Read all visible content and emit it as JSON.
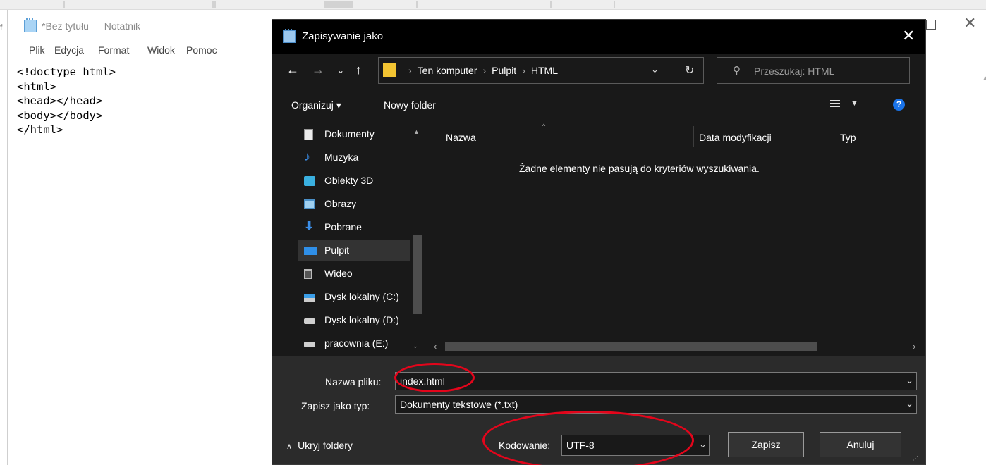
{
  "notepad": {
    "left_letter": "f",
    "title": "*Bez tytułu — Notatnik",
    "menu": [
      "Plik",
      "Edycja",
      "Format",
      "Widok",
      "Pomoc"
    ],
    "lines": [
      "<!doctype html>",
      "<html>",
      "<head></head>",
      "<body></body>",
      "</html>"
    ]
  },
  "dialog": {
    "title": "Zapisywanie jako",
    "address": {
      "segments": [
        "Ten komputer",
        "Pulpit",
        "HTML"
      ]
    },
    "search_placeholder": "Przeszukaj: HTML",
    "toolbar": {
      "organize": "Organizuj ▾",
      "new_folder": "Nowy folder"
    },
    "nav": {
      "items": [
        {
          "label": "Dokumenty",
          "icon": "documents-icon"
        },
        {
          "label": "Muzyka",
          "icon": "music-icon"
        },
        {
          "label": "Obiekty 3D",
          "icon": "objects-3d-icon"
        },
        {
          "label": "Obrazy",
          "icon": "pictures-icon"
        },
        {
          "label": "Pobrane",
          "icon": "downloads-icon"
        },
        {
          "label": "Pulpit",
          "icon": "desktop-icon",
          "selected": true
        },
        {
          "label": "Wideo",
          "icon": "video-icon"
        },
        {
          "label": "Dysk lokalny (C:)",
          "icon": "drive-c-icon"
        },
        {
          "label": "Dysk lokalny (D:)",
          "icon": "drive-icon"
        },
        {
          "label": "pracownia (E:)",
          "icon": "drive-icon"
        }
      ]
    },
    "columns": [
      "Nazwa",
      "Data modyfikacji",
      "Typ"
    ],
    "empty_message": "Żadne elementy nie pasują do kryteriów wyszukiwania.",
    "filename_label": "Nazwa pliku:",
    "filename_value": "index.html",
    "filetype_label": "Zapisz jako typ:",
    "filetype_value": "Dokumenty tekstowe (*.txt)",
    "encoding_label": "Kodowanie:",
    "encoding_value": "UTF-8",
    "hide_folders": "Ukryj foldery",
    "save_label": "Zapisz",
    "cancel_label": "Anuluj"
  },
  "colors": {
    "dialog_bg": "#191919",
    "dialog_bottom_bg": "#2b2b2b",
    "annotation_red": "#e3051b",
    "help_blue": "#1a73e8",
    "folder_yellow": "#f3c432"
  }
}
